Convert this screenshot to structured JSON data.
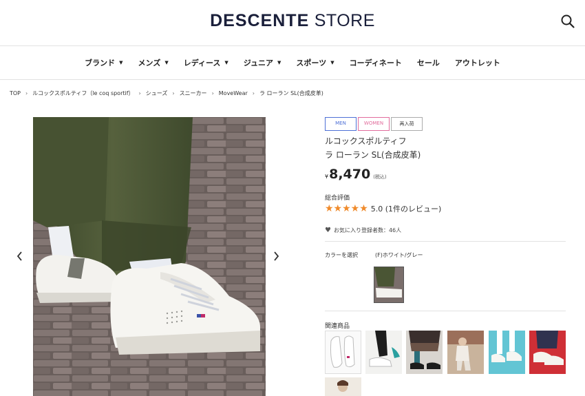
{
  "header": {
    "logo_main": "DESCENTE",
    "logo_sub": "STORE"
  },
  "nav": {
    "items": [
      {
        "label": "ブランド",
        "caret": "▼"
      },
      {
        "label": "メンズ",
        "caret": "▼"
      },
      {
        "label": "レディース",
        "caret": "▼"
      },
      {
        "label": "ジュニア",
        "caret": "▼"
      },
      {
        "label": "スポーツ",
        "caret": "▼"
      },
      {
        "label": "コーディネート",
        "caret": ""
      },
      {
        "label": "セール",
        "caret": ""
      },
      {
        "label": "アウトレット",
        "caret": ""
      }
    ]
  },
  "breadcrumb": {
    "items": [
      "TOP",
      "ルコックスポルティフ（le coq sportif）",
      "シューズ",
      "スニーカー",
      "MoveWear",
      "ラ ローラン SL(合成皮革)"
    ],
    "separator": "›"
  },
  "product": {
    "tags": [
      "MEN",
      "WOMEN",
      "再入荷"
    ],
    "brand": "ルコックスポルティフ",
    "name": "ラ ローラン SL(合成皮革)",
    "currency": "¥",
    "price": "8,470",
    "tax_note": "(税込)",
    "rating_label": "総合評価",
    "stars": "★★★★★",
    "rating_text": "5.0 (1件のレビュー)",
    "favorites": "お気に入り登録者数：46人",
    "color_label": "カラーを選択",
    "color_value": "(F)ホワイト/グレー",
    "related_label": "関連商品"
  },
  "colors": {
    "accent_star": "#f08a2a",
    "tag_men": "#4d6fd6",
    "tag_women": "#e16b9b",
    "logo": "#1a1f3a"
  }
}
